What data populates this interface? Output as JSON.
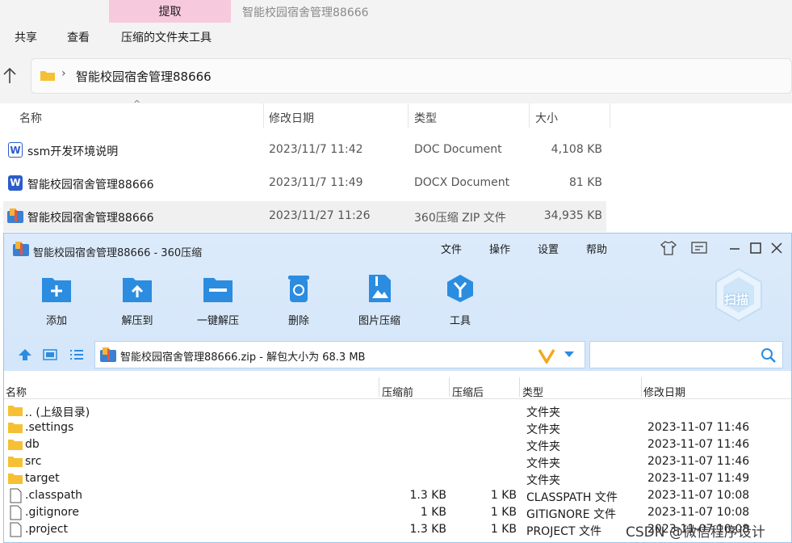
{
  "explorer": {
    "extract_tab": "提取",
    "title": "智能校园宿舍管理88666",
    "ribbon": [
      "共享",
      "查看",
      "压缩的文件夹工具"
    ],
    "address": "智能校园宿舍管理88666",
    "columns": {
      "name": "名称",
      "date": "修改日期",
      "type": "类型",
      "size": "大小"
    },
    "files": [
      {
        "name": "ssm开发环境说明",
        "date": "2023/11/7 11:42",
        "type": "DOC Document",
        "size": "4,108 KB",
        "icon": "word-doc-icon"
      },
      {
        "name": "智能校园宿舍管理88666",
        "date": "2023/11/7 11:49",
        "type": "DOCX Document",
        "size": "81 KB",
        "icon": "word-docx-icon"
      },
      {
        "name": "智能校园宿舍管理88666",
        "date": "2023/11/27 11:26",
        "type": "360压缩 ZIP 文件",
        "size": "34,935 KB",
        "icon": "zip-archive-icon"
      }
    ]
  },
  "zipwin": {
    "title": "智能校园宿舍管理88666 - 360压缩",
    "menu": [
      "文件",
      "操作",
      "设置",
      "帮助"
    ],
    "toolbar": [
      "添加",
      "解压到",
      "一键解压",
      "删除",
      "图片压缩",
      "工具"
    ],
    "scan_label": "扫描",
    "path": "智能校园宿舍管理88666.zip - 解包大小为 68.3 MB",
    "columns": {
      "name": "名称",
      "before": "压缩前",
      "after": "压缩后",
      "type": "类型",
      "date": "修改日期"
    },
    "rows": [
      {
        "name": ".. (上级目录)",
        "before": "",
        "after": "",
        "type": "文件夹",
        "date": "",
        "icon": "folder"
      },
      {
        "name": ".settings",
        "before": "",
        "after": "",
        "type": "文件夹",
        "date": "2023-11-07 11:46",
        "icon": "folder"
      },
      {
        "name": "db",
        "before": "",
        "after": "",
        "type": "文件夹",
        "date": "2023-11-07 11:46",
        "icon": "folder"
      },
      {
        "name": "src",
        "before": "",
        "after": "",
        "type": "文件夹",
        "date": "2023-11-07 11:46",
        "icon": "folder"
      },
      {
        "name": "target",
        "before": "",
        "after": "",
        "type": "文件夹",
        "date": "2023-11-07 11:49",
        "icon": "folder"
      },
      {
        "name": ".classpath",
        "before": "1.3 KB",
        "after": "1 KB",
        "type": "CLASSPATH 文件",
        "date": "2023-11-07 10:08",
        "icon": "file"
      },
      {
        "name": ".gitignore",
        "before": "1 KB",
        "after": "1 KB",
        "type": "GITIGNORE 文件",
        "date": "2023-11-07 10:08",
        "icon": "file"
      },
      {
        "name": ".project",
        "before": "1.3 KB",
        "after": "1 KB",
        "type": "PROJECT 文件",
        "date": "2023-11-07 10:08",
        "icon": "file"
      }
    ]
  },
  "watermark": "CSDN @微信程序设计",
  "colors": {
    "accent": "#2b8ce0",
    "tab_pink": "#f7c9dd",
    "header_blue": "#d4e6fa",
    "folder": "#f5c033"
  }
}
